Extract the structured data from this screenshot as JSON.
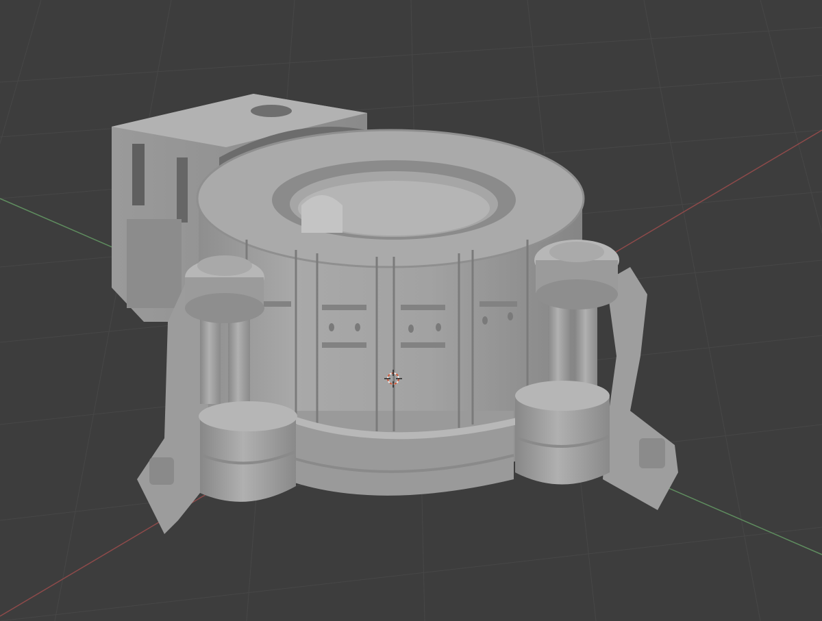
{
  "viewport": {
    "mode": "solid",
    "background": "#3d3d3d",
    "grid_color": "#4a4a4a",
    "x_axis_color": "#9a4a4a",
    "y_axis_color": "#5a8a5a",
    "mesh_color": "#a3a3a3"
  },
  "scene": {
    "objects": [
      {
        "name": "cylindrical-reactor-core",
        "icon": "mesh-icon"
      },
      {
        "name": "rear-block",
        "icon": "mesh-icon"
      },
      {
        "name": "left-piston-assembly",
        "icon": "mesh-icon"
      },
      {
        "name": "right-piston-assembly",
        "icon": "mesh-icon"
      }
    ],
    "origin_marker": "3d-cursor-icon"
  }
}
